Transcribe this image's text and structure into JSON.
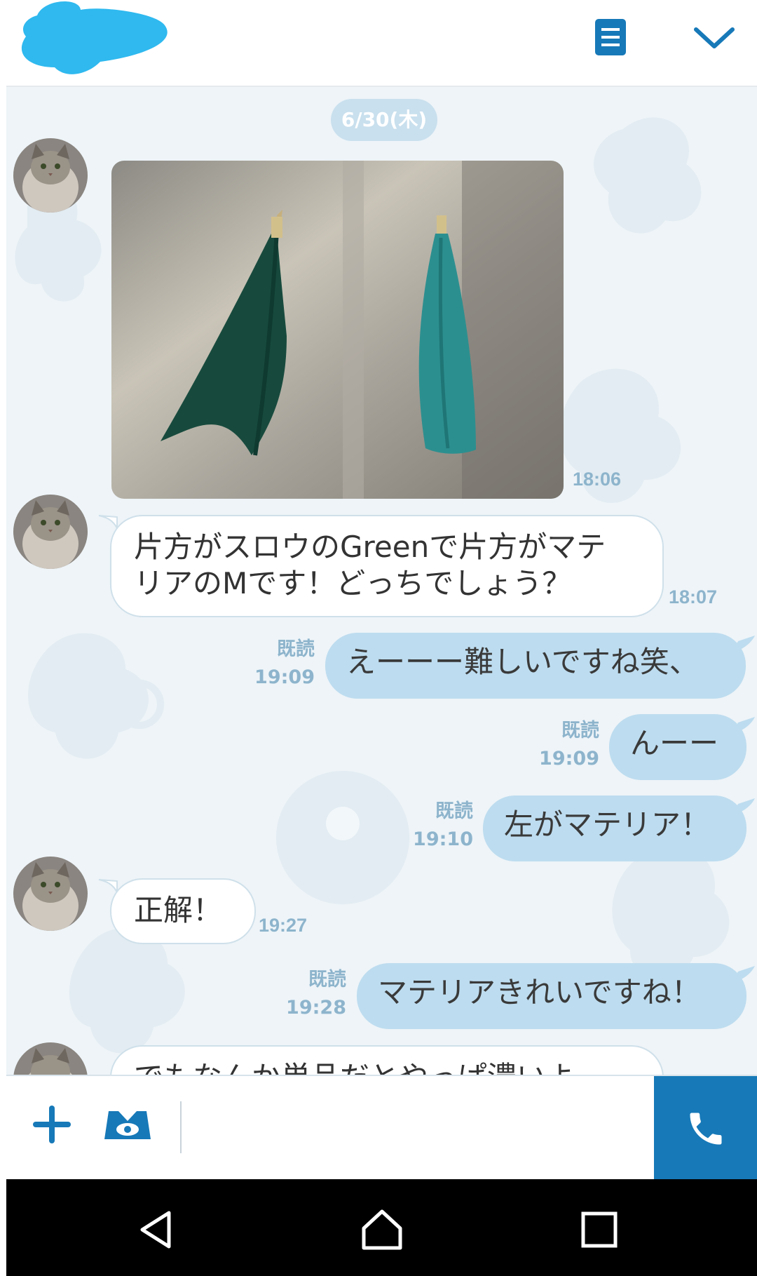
{
  "header": {
    "notes_icon": "notes-icon",
    "menu_icon": "chevron-down-icon"
  },
  "chat": {
    "date_separator": "6/30(木)",
    "messages": [
      {
        "side": "in",
        "type": "image",
        "time": "18:06"
      },
      {
        "side": "in",
        "type": "text",
        "lines": [
          "片方がスロウのGreenで片方がマテ",
          "リアのMです！どっちでしょう？"
        ],
        "time": "18:07"
      },
      {
        "side": "out",
        "type": "text",
        "text": "えーーー難しいですね笑、",
        "read": "既読",
        "time": "19:09"
      },
      {
        "side": "out",
        "type": "text",
        "text": "んーー",
        "read": "既読",
        "time": "19:09"
      },
      {
        "side": "out",
        "type": "text",
        "text": "左がマテリア！",
        "read": "既読",
        "time": "19:10"
      },
      {
        "side": "in",
        "type": "text",
        "text": "正解！",
        "time": "19:27"
      },
      {
        "side": "out",
        "type": "text",
        "text": "マテリアきれいですね！",
        "read": "既読",
        "time": "19:28"
      },
      {
        "side": "in",
        "type": "text",
        "text": "でもなんか単品だとやっぱ濃いよ",
        "partial": true
      }
    ]
  },
  "input_bar": {
    "add_icon": "plus-icon",
    "sticker_icon": "sticker-icon",
    "call_icon": "phone-icon"
  },
  "nav_bar": {
    "back_icon": "back-icon",
    "home_icon": "home-icon",
    "recents_icon": "recents-icon"
  },
  "colors": {
    "accent": "#1779b8",
    "outgoing_bubble": "#bddcef",
    "meta_text": "#8db4cc",
    "name_blob": "#2fb9ef"
  }
}
